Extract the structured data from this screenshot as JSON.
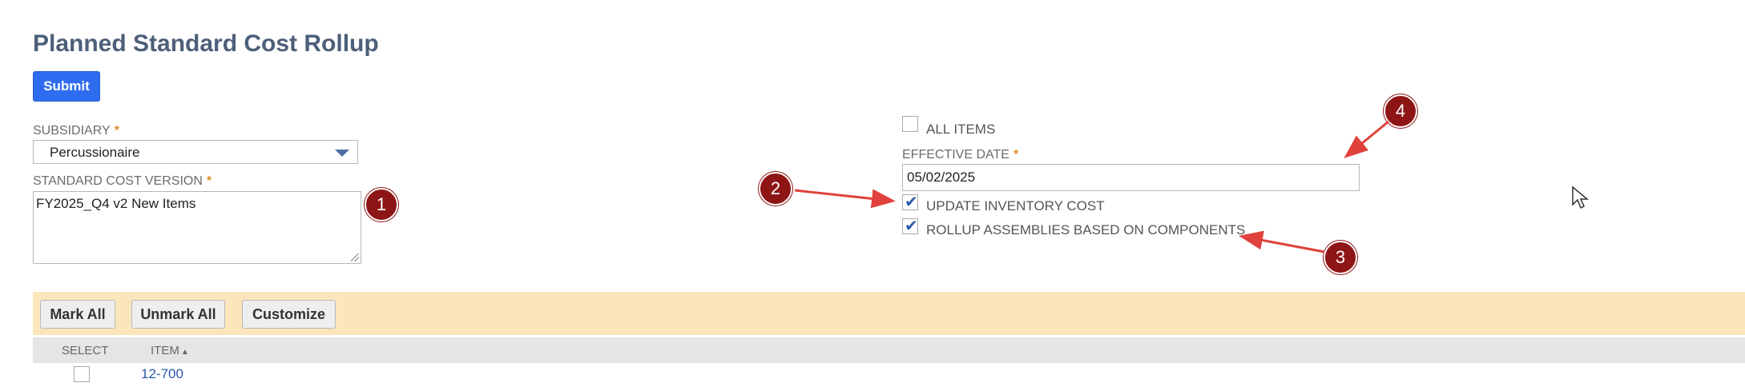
{
  "page": {
    "title": "Planned Standard Cost Rollup",
    "submit_label": "Submit"
  },
  "form": {
    "subsidiary": {
      "label": "SUBSIDIARY",
      "required_mark": "*",
      "value": "Percussionaire"
    },
    "cost_version": {
      "label": "STANDARD COST VERSION",
      "required_mark": "*",
      "value": "FY2025_Q4 v2 New Items"
    },
    "all_items": {
      "label": "ALL ITEMS",
      "checked": false
    },
    "effective_date": {
      "label": "EFFECTIVE DATE",
      "required_mark": "*",
      "value": "05/02/2025"
    },
    "update_inventory_cost": {
      "label": "UPDATE INVENTORY COST",
      "checked": true
    },
    "rollup_assemblies": {
      "label": "ROLLUP ASSEMBLIES BASED ON COMPONENTS",
      "checked": true
    }
  },
  "annotations": {
    "m1": "1",
    "m2": "2",
    "m3": "3",
    "m4": "4",
    "color": "#8e1515",
    "arrow_color": "#e0413c"
  },
  "list": {
    "buttons": {
      "mark_all": "Mark All",
      "unmark_all": "Unmark All",
      "customize": "Customize"
    },
    "columns": {
      "select": "SELECT",
      "item": "ITEM"
    },
    "rows": [
      {
        "selected": false,
        "item": "12-700"
      }
    ]
  },
  "icons": [
    "dropdown-arrow-icon",
    "check-icon",
    "resize-grip-icon",
    "sort-up-icon",
    "mouse-cursor-icon"
  ]
}
